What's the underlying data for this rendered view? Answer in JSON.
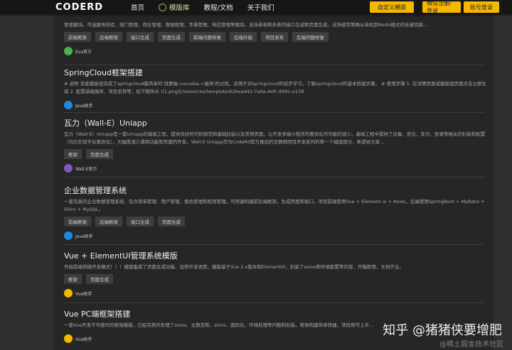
{
  "nav": {
    "logo": "CODERD",
    "items": [
      "首页",
      "模版库",
      "教程/文档",
      "关于我们"
    ],
    "active_index": 1,
    "buttons": [
      "自定义模版",
      "微信注册/登录",
      "账号登录"
    ],
    "accent": "#f5b700"
  },
  "cards": [
    {
      "title": "",
      "desc": "管理模块。可选服务校验、部门管理、岗位管理、数据权限、字典管理、响应管理等模块。支持单表和多表的接口生成和页面生成，支持缓存策略从单机到Redis模式的无缝切换…",
      "tags": [
        "前端框架",
        "后端框架",
        "接口生成",
        "页面生成",
        "前端问题修复",
        "后端升级",
        "项目发布",
        "后端问题修复"
      ],
      "author": "Eva官方"
    },
    {
      "title": "SpringCloud框架搭建",
      "desc": "# 说明 该套模板但完成了springcloud最简单的'消费端->eureka->服务'的过程。适用于对springcloud的初步学习，了解springcloud的基本搭建步骤。 # 使用步骤 1. 在详情页面或模版组页面点击立即生成 2. 配置基础服务、项目名称等，如下图所示 ![1.png](/resources/template/62bea442-7a4a-4efc-9991-e138",
      "tags": [],
      "author": "Java助手"
    },
    {
      "title": "瓦力（Wall-E）Uniapp",
      "desc": "瓦力（Wall-E）Uniapp是一套Uniapp的基础工程，提供良好的代码规范和基础封装以及常用页面，让开发多端小程序的差异化尽可能的减少。基础工程中提供了设备、定位、支付、登录等相关的封装和配置（均已实现平台差异化），大幅度减少通用功能和页面的开发。Wall-E Uniapp作为CodeRd官方推出的互联网项目开发系列的第一个组成部分，希望给大家…",
      "tags": [
        "框架",
        "页面生成"
      ],
      "author": "Wall-E官方"
    },
    {
      "title": "企业数据管理系统",
      "desc": "一套完善的企业数据管理系统，包含菜单管理、用户管理、角色管理和权限管理。可快速构建前后端框架，生成页面和接口。项目前端使用Vue + Element-ui + Axios，后端使用SpringBoot + MyBatis + Shiro + MySQL。",
      "tags": [
        "前端框架",
        "后端框架",
        "接口生成",
        "页面生成"
      ],
      "author": "Java助手"
    },
    {
      "title": "Vue + ElementUI管理系统模版",
      "desc": "开启前端快捷开发模式！！！模版集成了页面生成功能，加快开发进度。模版基于Vue 2.x版本和ElementUI，封装了axios和环境配置等内容，开箱即用，文档齐全。",
      "tags": [
        "框架",
        "页面生成"
      ],
      "author": "Vue助手"
    },
    {
      "title": "Vue PC端框架搭建",
      "desc": "一套Vue开发不可替代的框架模版，已经完美的处理了axios、主题定制、store、国际化、环境处理等问题和封装。框架构建简单快捷，项目即可上手…",
      "tags": [],
      "author": "Vue助手"
    }
  ],
  "watermark": {
    "line1": "知乎 @猪猪侠要增肥",
    "line2": "@稀土掘金技术社区"
  }
}
